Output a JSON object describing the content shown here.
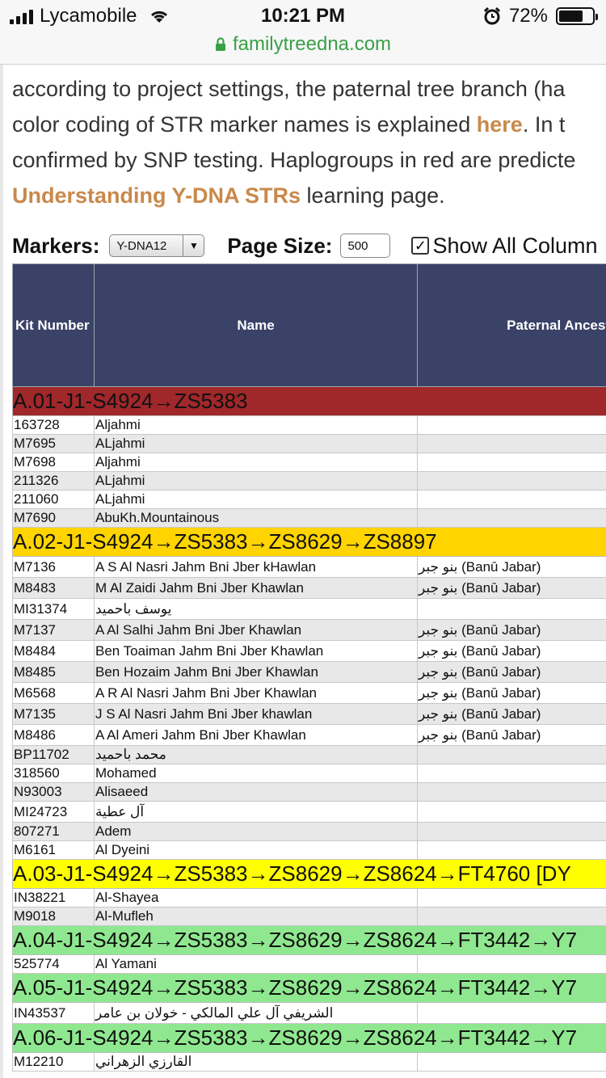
{
  "status_bar": {
    "carrier": "Lycamobile",
    "time": "10:21 PM",
    "battery_percent": "72%",
    "battery_level": 0.72
  },
  "url_bar": {
    "domain": "familytreedna.com"
  },
  "intro": {
    "line1": "according to project settings, the paternal tree branch (ha",
    "line2_a": "color coding of STR marker names is explained ",
    "line2_link": "here",
    "line2_b": ". In t",
    "line3": "confirmed by SNP testing. Haplogroups in red are predicte",
    "line4_link": "Understanding Y-DNA STRs",
    "line4_b": " learning page."
  },
  "controls": {
    "markers_label": "Markers:",
    "markers_value": "Y-DNA12",
    "page_size_label": "Page Size:",
    "page_size_value": "500",
    "show_all_label": "Show All Column",
    "show_all_checked": true
  },
  "table": {
    "headers": [
      "Kit Number",
      "Name",
      "Paternal Ancest"
    ],
    "rows": [
      {
        "type": "group",
        "label": "A.01-J1-S4924→ZS5383",
        "bg": "#a0272a",
        "fg": "#111111"
      },
      {
        "type": "row",
        "kit": "163728",
        "name": "Aljahmi",
        "anc": ""
      },
      {
        "type": "row",
        "kit": "M7695",
        "name": "ALjahmi",
        "anc": ""
      },
      {
        "type": "row",
        "kit": "M7698",
        "name": "Aljahmi",
        "anc": ""
      },
      {
        "type": "row",
        "kit": "211326",
        "name": "ALjahmi",
        "anc": ""
      },
      {
        "type": "row",
        "kit": "211060",
        "name": "ALjahmi",
        "anc": ""
      },
      {
        "type": "row",
        "kit": "M7690",
        "name": "AbuKh.Mountainous",
        "anc": ""
      },
      {
        "type": "group",
        "label": "A.02-J1-S4924→ZS5383→ZS8629→ZS8897",
        "bg": "#ffd400",
        "fg": "#111111"
      },
      {
        "type": "row",
        "kit": "M7136",
        "name": "A S Al Nasri Jahm Bni Jber kHawlan",
        "anc": "بنو جبر (Banū Jabar)",
        "tall": true
      },
      {
        "type": "row",
        "kit": "M8483",
        "name": "M Al Zaidi Jahm Bni Jber Khawlan",
        "anc": "بنو جبر (Banū Jabar)",
        "tall": true
      },
      {
        "type": "row",
        "kit": "MI31374",
        "name": "يوسف باحميد",
        "anc": "",
        "tall": true
      },
      {
        "type": "row",
        "kit": "M7137",
        "name": "A Al Salhi Jahm Bni Jber Khawlan",
        "anc": "بنو جبر (Banū Jabar)",
        "tall": true
      },
      {
        "type": "row",
        "kit": "M8484",
        "name": "Ben Toaiman Jahm Bni Jber Khawlan",
        "anc": "بنو جبر (Banū Jabar)",
        "tall": true
      },
      {
        "type": "row",
        "kit": "M8485",
        "name": "Ben Hozaim Jahm Bni Jber Khawlan",
        "anc": "بنو جبر (Banū Jabar)",
        "tall": true
      },
      {
        "type": "row",
        "kit": "M6568",
        "name": "A R Al Nasri Jahm Bni Jber Khawlan",
        "anc": "بنو جبر (Banū Jabar)",
        "tall": true
      },
      {
        "type": "row",
        "kit": "M7135",
        "name": "J S Al Nasri Jahm Bni Jber khawlan",
        "anc": "بنو جبر (Banū Jabar)",
        "tall": true
      },
      {
        "type": "row",
        "kit": "M8486",
        "name": "A Al Ameri Jahm Bni Jber Khawlan",
        "anc": "بنو جبر (Banū Jabar)",
        "tall": true
      },
      {
        "type": "row",
        "kit": "BP11702",
        "name": "محمد باحميد",
        "anc": ""
      },
      {
        "type": "row",
        "kit": "318560",
        "name": "Mohamed",
        "anc": ""
      },
      {
        "type": "row",
        "kit": "N93003",
        "name": "Alisaeed",
        "anc": ""
      },
      {
        "type": "row",
        "kit": "MI24723",
        "name": "آل عطية",
        "anc": "",
        "tall": true
      },
      {
        "type": "row",
        "kit": "807271",
        "name": "Adem",
        "anc": ""
      },
      {
        "type": "row",
        "kit": "M6161",
        "name": "Al Dyeini",
        "anc": ""
      },
      {
        "type": "group",
        "label": "A.03-J1-S4924→ZS5383→ZS8629→ZS8624→FT4760 [DY",
        "bg": "#ffff00",
        "fg": "#111111"
      },
      {
        "type": "row",
        "kit": "IN38221",
        "name": "Al-Shayea",
        "anc": ""
      },
      {
        "type": "row",
        "kit": "M9018",
        "name": "Al-Mufleh",
        "anc": ""
      },
      {
        "type": "group",
        "label": "A.04-J1-S4924→ZS5383→ZS8629→ZS8624→FT3442→Y7",
        "bg": "#8fe88f",
        "fg": "#111111"
      },
      {
        "type": "row",
        "kit": "525774",
        "name": "Al Yamani",
        "anc": ""
      },
      {
        "type": "group",
        "label": "A.05-J1-S4924→ZS5383→ZS8629→ZS8624→FT3442→Y7",
        "bg": "#8fe88f",
        "fg": "#111111"
      },
      {
        "type": "row",
        "kit": "IN43537",
        "name": "الشريفي آل علي المالكي - خولان بن عامر",
        "anc": "",
        "tall": true
      },
      {
        "type": "group",
        "label": "A.06-J1-S4924→ZS5383→ZS8629→ZS8624→FT3442→Y7",
        "bg": "#8fe88f",
        "fg": "#111111"
      },
      {
        "type": "row",
        "kit": "M12210",
        "name": "القارزي الزهراني",
        "anc": ""
      }
    ]
  }
}
